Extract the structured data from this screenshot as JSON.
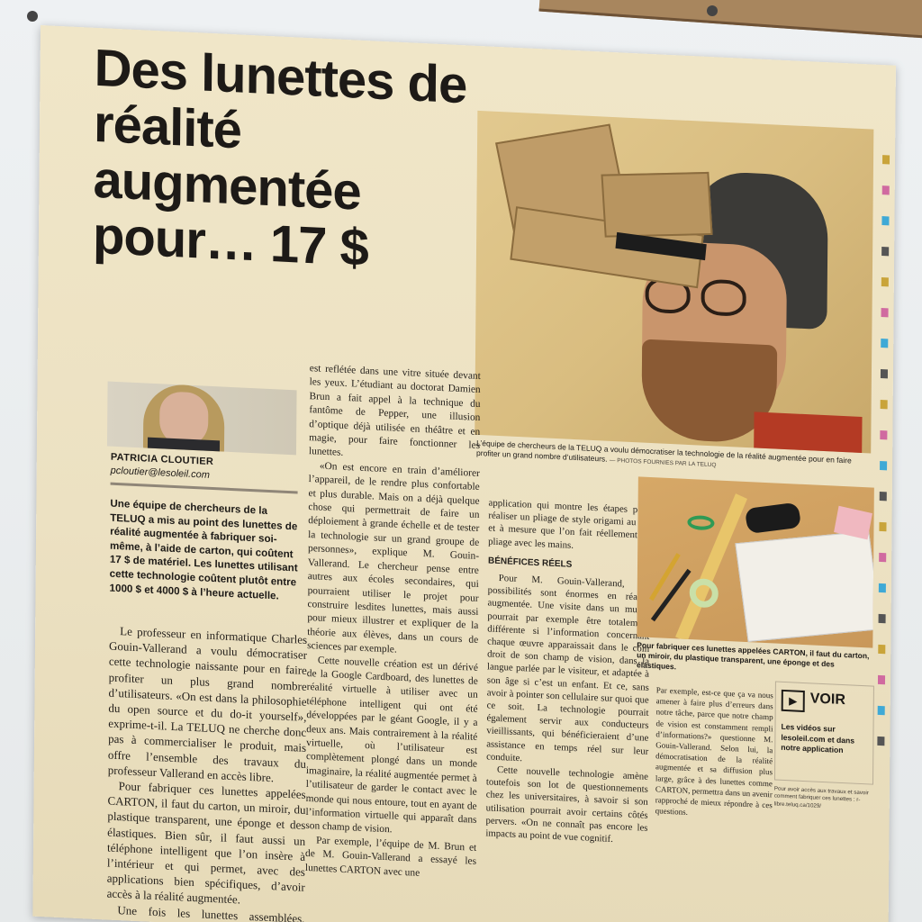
{
  "article": {
    "headline": "Des lunettes de réalité augmentée pour… 17 $",
    "author_name": "PATRICIA CLOUTIER",
    "author_email": "pcloutier@lesoleil.com",
    "lead": "Une équipe de chercheurs de la TELUQ a mis au point des lunettes de réalité augmentée à fabriquer soi-même, à l’aide de carton, qui coûtent 17 $ de matériel. Les lunettes utilisant cette technologie coûtent plutôt entre 1000 $ et 4000 $ à l’heure actuelle.",
    "col1_p1": "Le professeur en informatique Charles Gouin-Vallerand a voulu démocratiser cette technologie naissante pour en faire profiter un plus grand nombre d’utilisateurs. «On est dans la philosophie du open source et du do-it yourself», exprime-t-il. La TELUQ ne cherche donc pas à commercialiser le produit, mais offre l’ensemble des travaux du professeur Vallerand en accès libre.",
    "col1_p2": "Pour fabriquer ces lunettes appelées CARTON, il faut du carton, un miroir, du plastique transparent, une éponge et des élastiques. Bien sûr, il faut aussi un téléphone intelligent que l’on insère à l’intérieur et qui permet, avec des applications bien spécifiques, d’avoir accès à la réalité augmentée.",
    "col1_p3": "Une fois les lunettes assemblées, l’information du téléphone",
    "col2_p1": "est reflétée dans une vitre située devant les yeux. L’étudiant au doctorat Damien Brun a fait appel à la technique du fantôme de Pepper, une illusion d’optique déjà utilisée en théâtre et en magie, pour faire fonctionner les lunettes.",
    "col2_p2": "«On est encore en train d’améliorer l’appareil, de le rendre plus confortable et plus durable. Mais on a déjà quelque chose qui permettrait de faire un déploiement à grande échelle et de tester la technologie sur un grand groupe de personnes», explique M. Gouin-Vallerand. Le chercheur pense entre autres aux écoles secondaires, qui pourraient utiliser le projet pour construire lesdites lunettes, mais aussi pour mieux illustrer et expliquer de la théorie aux élèves, dans un cours de sciences par exemple.",
    "col2_p3": "Cette nouvelle création est un dérivé de la Google Cardboard, des lunettes de réalité virtuelle à utiliser avec un téléphone intelligent qui ont été développées par le géant Google, il y a deux ans. Mais contrairement à la réalité virtuelle, où l’utilisateur est complètement plongé dans un monde imaginaire, la réalité augmentée permet à l’utilisateur de garder le contact avec le monde qui nous entoure, tout en ayant de l’information virtuelle qui apparaît dans son champ de vision.",
    "col2_p4": "Par exemple, l’équipe de M. Brun et de M. Gouin-Vallerand a essayé les lunettes CARTON avec une",
    "col3_p1": "application qui montre les étapes pour réaliser un pliage de style origami au fur et à mesure que l’on fait réellement ce pliage avec les mains.",
    "col3_subhead": "BÉNÉFICES RÉELS",
    "col3_p2": "Pour M. Gouin-Vallerand, les possibilités sont énormes en réalité augmentée. Une visite dans un musée pourrait par exemple être totalement différente si l’information concernant chaque œuvre apparaissait dans le coin droit de son champ de vision, dans la langue parlée par le visiteur, et adaptée à son âge si c’est un enfant. Et ce, sans avoir à pointer son cellulaire sur quoi que ce soit. La technologie pourrait également servir aux conducteurs vieillissants, qui bénéficieraient d’une assistance en temps réel sur leur conduite.",
    "col3_p3": "Cette nouvelle technologie amène toutefois son lot de questionnements chez les universitaires, à savoir si son utilisation pourrait avoir certains côtés pervers. «On ne connaît pas encore les impacts au point de vue cognitif.",
    "col4_p1": "Par exemple, est-ce que ça va nous amener à faire plus d’erreurs dans notre tâche, parce que notre champ de vision est constamment rempli d’informations?» questionne M. Gouin-Vallerand. Selon lui, la démocratisation de la réalité augmentée et sa diffusion plus large, grâce à des lunettes comme CARTON, permettra dans un avenir rapproché de mieux répondre à ces questions.",
    "caption_main": "L’équipe de chercheurs de la TELUQ a voulu démocratiser la technologie de la réalité augmentée pour en faire profiter un grand nombre d’utilisateurs.",
    "credit_main": "— PHOTOS FOURNIES PAR LA TELUQ",
    "caption_second": "Pour fabriquer ces lunettes appelées CARTON, il faut du carton, un miroir, du plastique transparent, une éponge et des élastiques.",
    "voir_label": "VOIR",
    "voir_text": "Les vidéos sur lesoleil.com et dans notre application",
    "voir_note": "Pour avoir accès aux travaux et savoir comment fabriquer ces lunettes : r-libre.teluq.ca/1029/"
  },
  "colors": {
    "paper": "#ece1c2",
    "ink": "#1d1a17",
    "wall": "#e8ebec"
  }
}
